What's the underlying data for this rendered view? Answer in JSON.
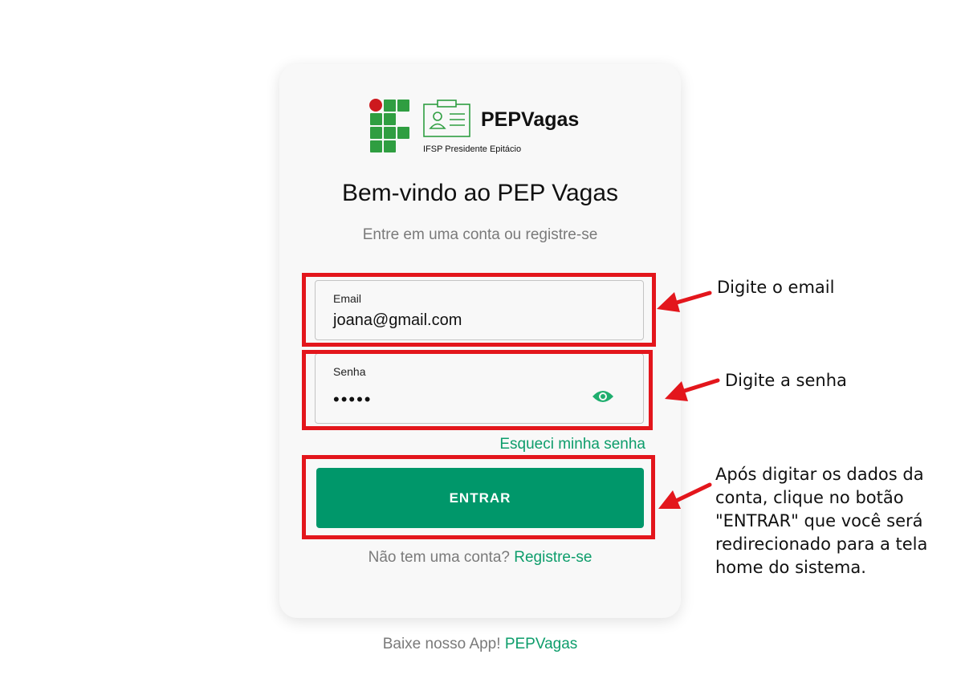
{
  "brand": {
    "name": "PEPVagas",
    "subtitle": "IFSP Presidente Epitácio",
    "logo_green": "#2f9e41",
    "logo_red": "#cd191e"
  },
  "header": {
    "title": "Bem-vindo ao PEP Vagas",
    "subtitle": "Entre em uma conta ou registre-se"
  },
  "form": {
    "email_label": "Email",
    "email_value": "joana@gmail.com",
    "password_label": "Senha",
    "password_value": "•••••",
    "password_toggle_icon": "eye-icon",
    "forgot_link": "Esqueci minha senha",
    "submit_label": "ENTRAR"
  },
  "register": {
    "prompt": "Não tem uma conta?",
    "link": "Registre-se"
  },
  "footer": {
    "prompt": "Baixe nosso App!",
    "link": "PEPVagas"
  },
  "annotations": {
    "email_note": "Digite o email",
    "password_note": "Digite a senha",
    "button_note": "Após digitar os dados da conta, clique no botão \"ENTRAR\" que você será redirecionado para a tela home do sistema.",
    "highlight_color": "#e3161c"
  },
  "colors": {
    "accent": "#00976a",
    "link": "#0d9d6b"
  }
}
